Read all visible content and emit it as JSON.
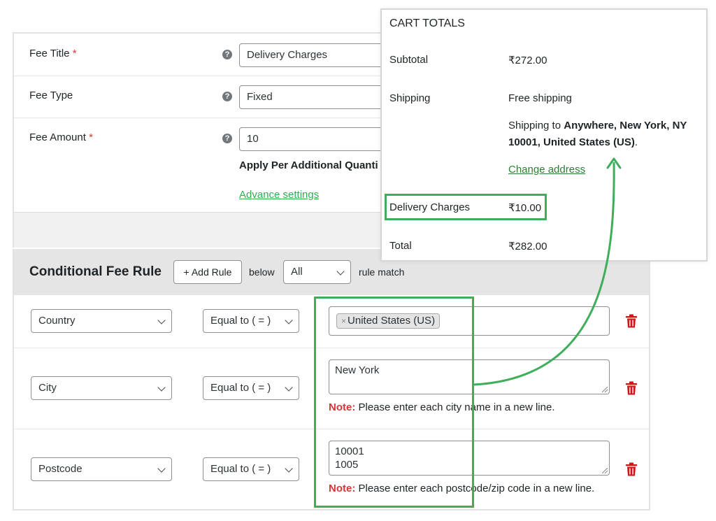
{
  "fee_settings": {
    "fee_title": {
      "label": "Fee Title",
      "required": "*",
      "value": "Delivery Charges"
    },
    "fee_type": {
      "label": "Fee Type",
      "value": "Fixed"
    },
    "fee_amount": {
      "label": "Fee Amount",
      "required": "*",
      "value": "10"
    },
    "apply_per_label": "Apply Per Additional Quanti",
    "advance_settings": "Advance settings",
    "help_glyph": "?"
  },
  "conditional_rules": {
    "title": "Conditional Fee Rule",
    "add_rule": "+ Add Rule",
    "below": "below",
    "match_value": "All",
    "rule_match": "rule match",
    "rules": [
      {
        "field": "Country",
        "operator": "Equal to ( = )",
        "tag_remove": "×",
        "tag": "United States (US)"
      },
      {
        "field": "City",
        "operator": "Equal to ( = )",
        "value_line1": "New York",
        "note_label": "Note:",
        "note_text": " Please enter each city name in a new line."
      },
      {
        "field": "Postcode",
        "operator": "Equal to ( = )",
        "value_line1": "10001",
        "value_line2": "1005",
        "note_label": "Note:",
        "note_text": " Please enter each postcode/zip code in a new line."
      }
    ]
  },
  "cart_totals": {
    "title": "CART TOTALS",
    "subtotal_label": "Subtotal",
    "subtotal_value": "₹272.00",
    "shipping_label": "Shipping",
    "shipping_value": "Free shipping",
    "ship_to_prefix": "Shipping to ",
    "ship_to_address": "Anywhere, New York, NY 10001, United States (US)",
    "ship_to_suffix": ".",
    "change_address": "Change address",
    "delivery_label": "Delivery Charges",
    "delivery_value": "₹10.00",
    "total_label": "Total",
    "total_value": "₹282.00"
  },
  "colors": {
    "highlight": "#3fae5b",
    "link_green": "#2eae50",
    "required_red": "#d63638",
    "trash_red": "#cc1818"
  },
  "icons": [
    "help-icon",
    "chevron-down-icon",
    "trash-icon",
    "tag-remove-icon",
    "arrow-icon"
  ]
}
